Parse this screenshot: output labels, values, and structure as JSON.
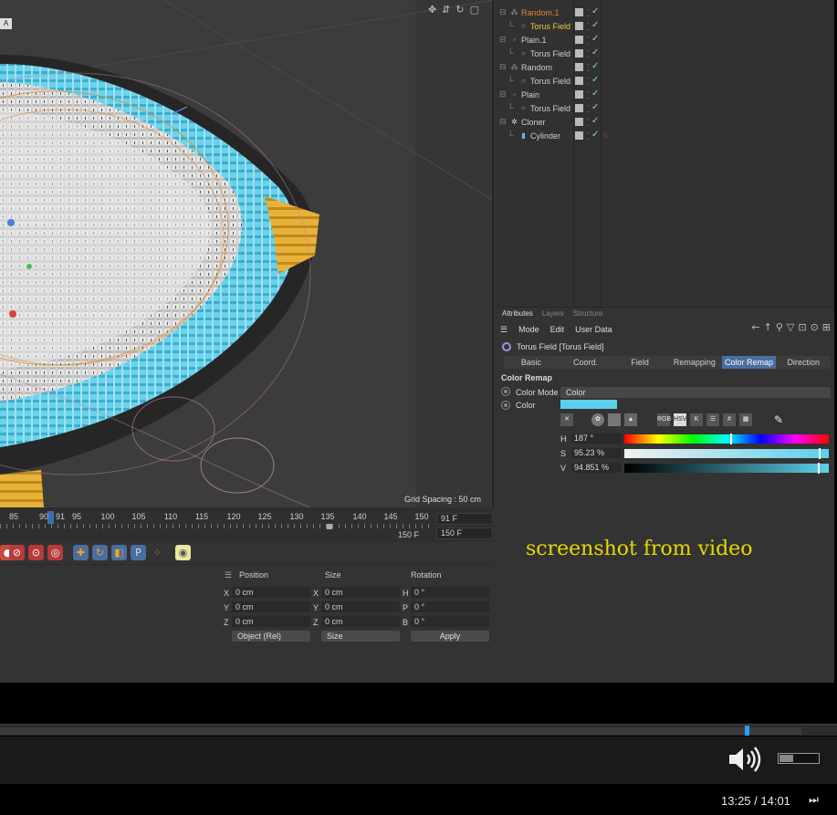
{
  "viewport": {
    "corner_label": "A",
    "grid_spacing": "Grid Spacing : 50 cm",
    "icons": [
      "move-view-icon",
      "pan-view-icon",
      "rotate-view-icon",
      "maximize-view-icon"
    ]
  },
  "timeline": {
    "ticks": [
      "85",
      "90",
      "91",
      "95",
      "100",
      "105",
      "110",
      "115",
      "120",
      "125",
      "130",
      "135",
      "140",
      "145",
      "150"
    ],
    "current_frame_field": "91 F",
    "end_frame_field": "150 F",
    "end_label": "150 F"
  },
  "coords": {
    "headers": {
      "position": "Position",
      "size": "Size",
      "rotation": "Rotation"
    },
    "rows": [
      {
        "pos_axis": "X",
        "pos": "0 cm",
        "size_axis": "X",
        "size": "0 cm",
        "rot_axis": "H",
        "rot": "0 °"
      },
      {
        "pos_axis": "Y",
        "pos": "0 cm",
        "size_axis": "Y",
        "size": "0 cm",
        "rot_axis": "P",
        "rot": "0 °"
      },
      {
        "pos_axis": "Z",
        "pos": "0 cm",
        "size_axis": "Z",
        "size": "0 cm",
        "rot_axis": "B",
        "rot": "0 °"
      }
    ],
    "mode_dropdown": "Object (Rel)",
    "size_dropdown": "Size",
    "apply": "Apply"
  },
  "object_manager": {
    "rows": [
      {
        "name": "Random.1",
        "level": 0,
        "icon": "random-icon",
        "color": "#e0803a",
        "tag": ""
      },
      {
        "name": "Torus Field",
        "level": 1,
        "icon": "torus-field-icon",
        "color": "#e8c84a",
        "tag": ""
      },
      {
        "name": "Plain.1",
        "level": 0,
        "icon": "plain-icon",
        "color": "#cfcfcf",
        "tag": ""
      },
      {
        "name": "Torus Field",
        "level": 1,
        "icon": "torus-field-icon",
        "color": "#cfcfcf",
        "tag": ""
      },
      {
        "name": "Random",
        "level": 0,
        "icon": "random-icon",
        "color": "#cfcfcf",
        "tag": ""
      },
      {
        "name": "Torus Field",
        "level": 1,
        "icon": "torus-field-icon",
        "color": "#cfcfcf",
        "tag": ""
      },
      {
        "name": "Plain",
        "level": 0,
        "icon": "plain-icon",
        "color": "#cfcfcf",
        "tag": ""
      },
      {
        "name": "Torus Field",
        "level": 1,
        "icon": "torus-field-icon",
        "color": "#cfcfcf",
        "tag": ""
      },
      {
        "name": "Cloner",
        "level": 0,
        "icon": "cloner-icon",
        "color": "#cfcfcf",
        "tag": ""
      },
      {
        "name": "Cylinder",
        "level": 1,
        "icon": "cylinder-icon",
        "color": "#cfcfcf",
        "tag": "material-tag"
      }
    ]
  },
  "attributes": {
    "tabs": [
      "Attributes",
      "Layers",
      "Structure"
    ],
    "menu": [
      "Mode",
      "Edit",
      "User Data"
    ],
    "object_title": "Torus Field [Torus Field]",
    "subtabs": [
      "Basic",
      "Coord.",
      "Field",
      "Remapping",
      "Color Remap",
      "Direction"
    ],
    "selected_subtab": "Color Remap",
    "section": "Color Remap",
    "color_mode_label": "Color Mode",
    "color_mode_value": "Color",
    "color_label": "Color",
    "color_swatch": "#5cd0ea",
    "picker_modes": [
      "RGB",
      "HSV",
      "K"
    ],
    "h_label": "H",
    "h_value": "187 °",
    "h_fraction": 0.52,
    "s_label": "S",
    "s_value": "95.23 %",
    "s_fraction": 0.9523,
    "v_label": "V",
    "v_value": "94.851 %",
    "v_fraction": 0.94851
  },
  "overlay_text": "screenshot from video",
  "player": {
    "time": "13:25 / 14:01",
    "progress": 0.957,
    "volume": 0.35
  }
}
